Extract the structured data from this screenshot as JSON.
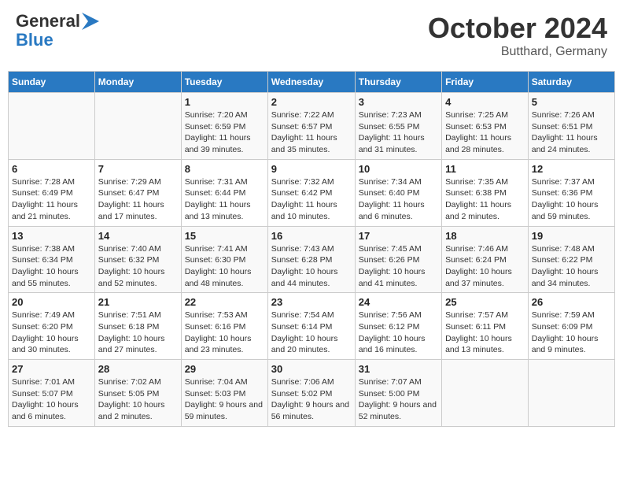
{
  "header": {
    "logo_line1": "General",
    "logo_line2": "Blue",
    "month": "October 2024",
    "location": "Butthard, Germany"
  },
  "weekdays": [
    "Sunday",
    "Monday",
    "Tuesday",
    "Wednesday",
    "Thursday",
    "Friday",
    "Saturday"
  ],
  "weeks": [
    [
      {
        "day": "",
        "info": ""
      },
      {
        "day": "",
        "info": ""
      },
      {
        "day": "1",
        "info": "Sunrise: 7:20 AM\nSunset: 6:59 PM\nDaylight: 11 hours and 39 minutes."
      },
      {
        "day": "2",
        "info": "Sunrise: 7:22 AM\nSunset: 6:57 PM\nDaylight: 11 hours and 35 minutes."
      },
      {
        "day": "3",
        "info": "Sunrise: 7:23 AM\nSunset: 6:55 PM\nDaylight: 11 hours and 31 minutes."
      },
      {
        "day": "4",
        "info": "Sunrise: 7:25 AM\nSunset: 6:53 PM\nDaylight: 11 hours and 28 minutes."
      },
      {
        "day": "5",
        "info": "Sunrise: 7:26 AM\nSunset: 6:51 PM\nDaylight: 11 hours and 24 minutes."
      }
    ],
    [
      {
        "day": "6",
        "info": "Sunrise: 7:28 AM\nSunset: 6:49 PM\nDaylight: 11 hours and 21 minutes."
      },
      {
        "day": "7",
        "info": "Sunrise: 7:29 AM\nSunset: 6:47 PM\nDaylight: 11 hours and 17 minutes."
      },
      {
        "day": "8",
        "info": "Sunrise: 7:31 AM\nSunset: 6:44 PM\nDaylight: 11 hours and 13 minutes."
      },
      {
        "day": "9",
        "info": "Sunrise: 7:32 AM\nSunset: 6:42 PM\nDaylight: 11 hours and 10 minutes."
      },
      {
        "day": "10",
        "info": "Sunrise: 7:34 AM\nSunset: 6:40 PM\nDaylight: 11 hours and 6 minutes."
      },
      {
        "day": "11",
        "info": "Sunrise: 7:35 AM\nSunset: 6:38 PM\nDaylight: 11 hours and 2 minutes."
      },
      {
        "day": "12",
        "info": "Sunrise: 7:37 AM\nSunset: 6:36 PM\nDaylight: 10 hours and 59 minutes."
      }
    ],
    [
      {
        "day": "13",
        "info": "Sunrise: 7:38 AM\nSunset: 6:34 PM\nDaylight: 10 hours and 55 minutes."
      },
      {
        "day": "14",
        "info": "Sunrise: 7:40 AM\nSunset: 6:32 PM\nDaylight: 10 hours and 52 minutes."
      },
      {
        "day": "15",
        "info": "Sunrise: 7:41 AM\nSunset: 6:30 PM\nDaylight: 10 hours and 48 minutes."
      },
      {
        "day": "16",
        "info": "Sunrise: 7:43 AM\nSunset: 6:28 PM\nDaylight: 10 hours and 44 minutes."
      },
      {
        "day": "17",
        "info": "Sunrise: 7:45 AM\nSunset: 6:26 PM\nDaylight: 10 hours and 41 minutes."
      },
      {
        "day": "18",
        "info": "Sunrise: 7:46 AM\nSunset: 6:24 PM\nDaylight: 10 hours and 37 minutes."
      },
      {
        "day": "19",
        "info": "Sunrise: 7:48 AM\nSunset: 6:22 PM\nDaylight: 10 hours and 34 minutes."
      }
    ],
    [
      {
        "day": "20",
        "info": "Sunrise: 7:49 AM\nSunset: 6:20 PM\nDaylight: 10 hours and 30 minutes."
      },
      {
        "day": "21",
        "info": "Sunrise: 7:51 AM\nSunset: 6:18 PM\nDaylight: 10 hours and 27 minutes."
      },
      {
        "day": "22",
        "info": "Sunrise: 7:53 AM\nSunset: 6:16 PM\nDaylight: 10 hours and 23 minutes."
      },
      {
        "day": "23",
        "info": "Sunrise: 7:54 AM\nSunset: 6:14 PM\nDaylight: 10 hours and 20 minutes."
      },
      {
        "day": "24",
        "info": "Sunrise: 7:56 AM\nSunset: 6:12 PM\nDaylight: 10 hours and 16 minutes."
      },
      {
        "day": "25",
        "info": "Sunrise: 7:57 AM\nSunset: 6:11 PM\nDaylight: 10 hours and 13 minutes."
      },
      {
        "day": "26",
        "info": "Sunrise: 7:59 AM\nSunset: 6:09 PM\nDaylight: 10 hours and 9 minutes."
      }
    ],
    [
      {
        "day": "27",
        "info": "Sunrise: 7:01 AM\nSunset: 5:07 PM\nDaylight: 10 hours and 6 minutes."
      },
      {
        "day": "28",
        "info": "Sunrise: 7:02 AM\nSunset: 5:05 PM\nDaylight: 10 hours and 2 minutes."
      },
      {
        "day": "29",
        "info": "Sunrise: 7:04 AM\nSunset: 5:03 PM\nDaylight: 9 hours and 59 minutes."
      },
      {
        "day": "30",
        "info": "Sunrise: 7:06 AM\nSunset: 5:02 PM\nDaylight: 9 hours and 56 minutes."
      },
      {
        "day": "31",
        "info": "Sunrise: 7:07 AM\nSunset: 5:00 PM\nDaylight: 9 hours and 52 minutes."
      },
      {
        "day": "",
        "info": ""
      },
      {
        "day": "",
        "info": ""
      }
    ]
  ]
}
